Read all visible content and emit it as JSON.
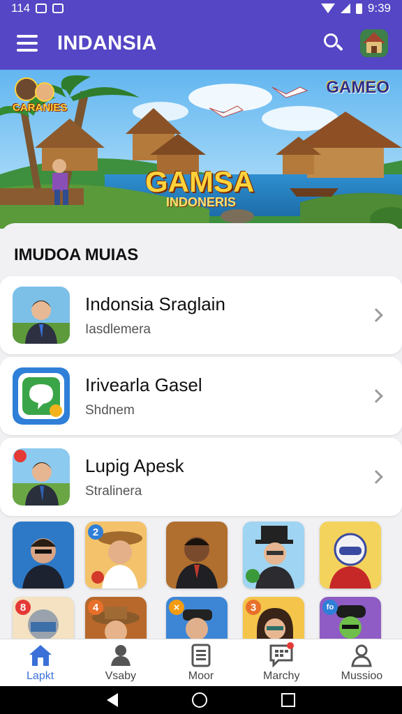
{
  "status_bar": {
    "time_left": "114",
    "time_right": "9:39"
  },
  "app_bar": {
    "title": "INDANSIA",
    "search_icon": "search-icon",
    "profile_icon": "hut-avatar-icon"
  },
  "banner": {
    "logo_left": "CARANIES",
    "logo_right": "GAMEO",
    "title": "GAMSA",
    "subtitle": "INDONERIS"
  },
  "section": {
    "title": "IMUDOA MUIAS"
  },
  "list": [
    {
      "title": "Indonsia Sraglain",
      "subtitle": "Iasdlemera",
      "icon": "man-avatar"
    },
    {
      "title": "Irivearla Gasel",
      "subtitle": "Shdnem",
      "icon": "chat-app-icon"
    },
    {
      "title": "Lupig Apesk",
      "subtitle": "Stralinera",
      "icon": "man-avatar-badge"
    }
  ],
  "tiles_row1": [
    {
      "badge": "",
      "icon": "man-glasses-avatar"
    },
    {
      "badge": "2",
      "icon": "explorer-avatar"
    },
    {
      "badge": "",
      "icon": "man-suit-avatar"
    },
    {
      "badge": "",
      "icon": "hat-man-avatar"
    },
    {
      "badge": "",
      "icon": "robot-helmet-avatar"
    }
  ],
  "tiles_row2": [
    {
      "badge": "8",
      "icon": "robot-avatar"
    },
    {
      "badge": "4",
      "icon": "safari-hat-avatar"
    },
    {
      "badge": "×",
      "icon": "cap-man-avatar"
    },
    {
      "badge": "3",
      "icon": "woman-glasses-avatar"
    },
    {
      "badge": "fo",
      "icon": "green-avatar"
    }
  ],
  "bottom_nav": [
    {
      "label": "Lapkt",
      "icon": "home-icon",
      "active": true
    },
    {
      "label": "Vsaby",
      "icon": "person-icon",
      "active": false
    },
    {
      "label": "Moor",
      "icon": "document-icon",
      "active": false
    },
    {
      "label": "Marchy",
      "icon": "chat-grid-icon",
      "active": false
    },
    {
      "label": "Mussioo",
      "icon": "user-outline-icon",
      "active": false
    }
  ],
  "colors": {
    "primary": "#5446c4",
    "active_nav": "#3a70d8",
    "background": "#f1f1f4"
  }
}
